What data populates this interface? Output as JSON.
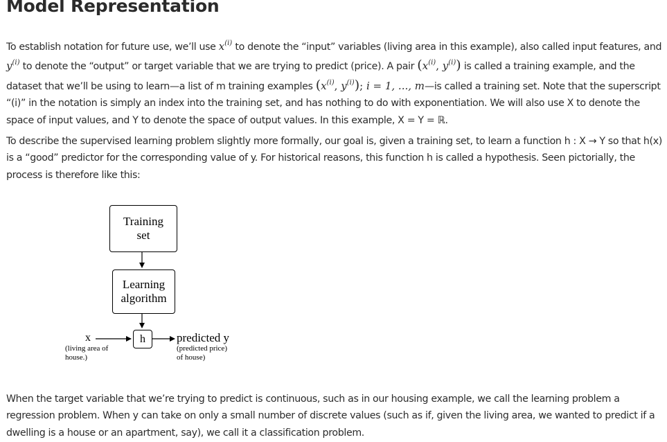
{
  "page": {
    "title": "Model Representation",
    "p1": {
      "t1": "To establish notation for future use, we’ll use ",
      "t2": " to denote the “input” variables (living area in this example), also called input features, and ",
      "t3": " to denote the “output” or target variable that we are trying to predict (price). A pair ",
      "t4": " is called a training example, and the dataset that we’ll be using to learn—a list of m training examples ",
      "t5": "—is called a training set. Note that the superscript “(i)” in the notation is simply an index into the training set, and has nothing to do with exponentiation. We will also use X to denote the space of input values, and Y to denote the space of output values. In this example, X = Y = ℝ."
    },
    "p2": "To describe the supervised learning problem slightly more formally, our goal is, given a training set, to learn a function h : X → Y so that h(x) is a “good” predictor for the corresponding value of y. For historical reasons, this function h is called a hypothesis. Seen pictorially, the process is therefore like this:",
    "p3": " When the target variable that we’re trying to predict is continuous, such as in our housing example, we call the learning problem a regression problem. When y can take on only a small number of discrete values (such as if, given the living area, we wanted to predict if a dwelling is a house or an apartment, say), we call it a classification problem.",
    "math": {
      "x": "x",
      "y": "y",
      "sup": "(i)",
      "pair_open": "(",
      "comma": ", ",
      "pair_close": ")",
      "semicolon": ";",
      "i_range": " i = 1, ..., m"
    }
  },
  "diagram": {
    "training_set": [
      "Training",
      "set"
    ],
    "learning_algorithm": [
      "Learning",
      "algorithm"
    ],
    "h": "h",
    "x_label": "x",
    "x_sub": [
      "(living area of",
      "house.)"
    ],
    "y_label": "predicted y",
    "y_sub": [
      "(predicted price)",
      "of house)"
    ]
  }
}
